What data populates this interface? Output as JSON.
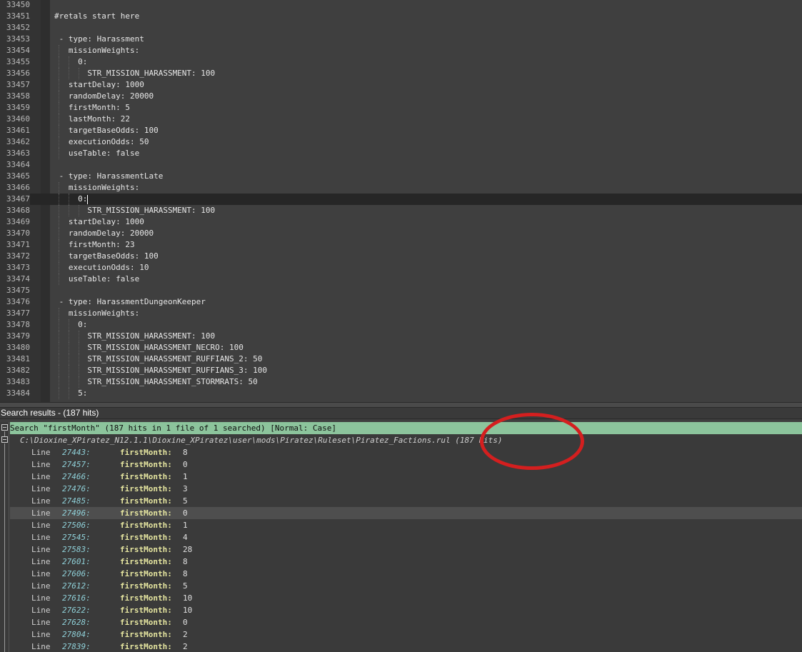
{
  "editor": {
    "lines": [
      {
        "num": "33450",
        "text": ""
      },
      {
        "num": "33451",
        "text": "#retals start here"
      },
      {
        "num": "33452",
        "text": ""
      },
      {
        "num": "33453",
        "text": " - type: Harassment"
      },
      {
        "num": "33454",
        "text": "   missionWeights:"
      },
      {
        "num": "33455",
        "text": "     0:"
      },
      {
        "num": "33456",
        "text": "       STR_MISSION_HARASSMENT: 100"
      },
      {
        "num": "33457",
        "text": "   startDelay: 1000"
      },
      {
        "num": "33458",
        "text": "   randomDelay: 20000"
      },
      {
        "num": "33459",
        "text": "   firstMonth: 5"
      },
      {
        "num": "33460",
        "text": "   lastMonth: 22"
      },
      {
        "num": "33461",
        "text": "   targetBaseOdds: 100"
      },
      {
        "num": "33462",
        "text": "   executionOdds: 50"
      },
      {
        "num": "33463",
        "text": "   useTable: false"
      },
      {
        "num": "33464",
        "text": ""
      },
      {
        "num": "33465",
        "text": " - type: HarassmentLate"
      },
      {
        "num": "33466",
        "text": "   missionWeights:"
      },
      {
        "num": "33467",
        "text": "     0:"
      },
      {
        "num": "33468",
        "text": "       STR_MISSION_HARASSMENT: 100"
      },
      {
        "num": "33469",
        "text": "   startDelay: 1000"
      },
      {
        "num": "33470",
        "text": "   randomDelay: 20000"
      },
      {
        "num": "33471",
        "text": "   firstMonth: 23"
      },
      {
        "num": "33472",
        "text": "   targetBaseOdds: 100"
      },
      {
        "num": "33473",
        "text": "   executionOdds: 10"
      },
      {
        "num": "33474",
        "text": "   useTable: false"
      },
      {
        "num": "33475",
        "text": ""
      },
      {
        "num": "33476",
        "text": " - type: HarassmentDungeonKeeper"
      },
      {
        "num": "33477",
        "text": "   missionWeights:"
      },
      {
        "num": "33478",
        "text": "     0:"
      },
      {
        "num": "33479",
        "text": "       STR_MISSION_HARASSMENT: 100"
      },
      {
        "num": "33480",
        "text": "       STR_MISSION_HARASSMENT_NECRO: 100"
      },
      {
        "num": "33481",
        "text": "       STR_MISSION_HARASSMENT_RUFFIANS_2: 50"
      },
      {
        "num": "33482",
        "text": "       STR_MISSION_HARASSMENT_RUFFIANS_3: 100"
      },
      {
        "num": "33483",
        "text": "       STR_MISSION_HARASSMENT_STORMRATS: 50"
      },
      {
        "num": "33484",
        "text": "     5:"
      }
    ],
    "caret_line": "33467"
  },
  "search_panel": {
    "title": "Search results - (187 hits)",
    "header": "Search \"firstMonth\" (187 hits in 1 file of 1 searched) [Normal: Case]",
    "file_path": "C:\\Dioxine_XPiratez_N12.1.1\\Dioxine_XPiratez\\user\\mods\\Piratez\\Ruleset\\Piratez_Factions.rul (187 hits)",
    "line_label": "Line",
    "key_label": "firstMonth:",
    "hits": [
      {
        "line": "27443:",
        "value": "8"
      },
      {
        "line": "27457:",
        "value": "0"
      },
      {
        "line": "27466:",
        "value": "1"
      },
      {
        "line": "27476:",
        "value": "3"
      },
      {
        "line": "27485:",
        "value": "5"
      },
      {
        "line": "27496:",
        "value": "0",
        "selected": true
      },
      {
        "line": "27506:",
        "value": "1"
      },
      {
        "line": "27545:",
        "value": "4"
      },
      {
        "line": "27583:",
        "value": "28"
      },
      {
        "line": "27601:",
        "value": "8"
      },
      {
        "line": "27606:",
        "value": "8"
      },
      {
        "line": "27612:",
        "value": "5"
      },
      {
        "line": "27616:",
        "value": "10"
      },
      {
        "line": "27622:",
        "value": "10"
      },
      {
        "line": "27628:",
        "value": "0"
      },
      {
        "line": "27804:",
        "value": "2"
      },
      {
        "line": "27839:",
        "value": "2"
      }
    ]
  },
  "colors": {
    "editor_bg": "#3f3f3f",
    "search_header_bg": "#8cc49c",
    "annotation": "#d41f1f",
    "line_number_link": "#8fd0d8"
  }
}
